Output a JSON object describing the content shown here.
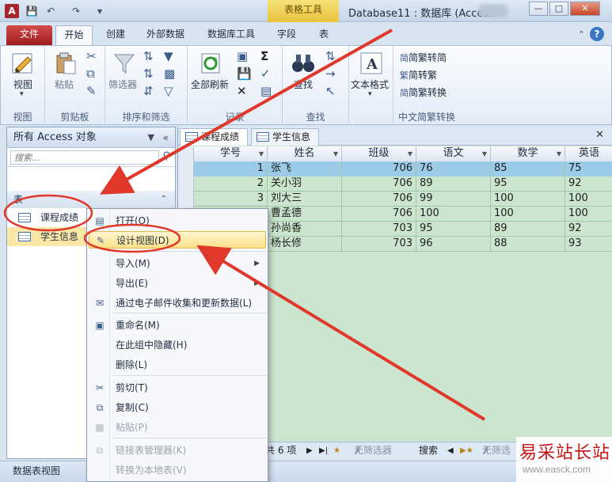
{
  "titlebar": {
    "app_icon": "A",
    "context_tab": "表格工具",
    "window_title": "Database11 : 数据库 (Access"
  },
  "ribbon_tabs": [
    "文件",
    "开始",
    "创建",
    "外部数据",
    "数据库工具",
    "字段",
    "表"
  ],
  "ribbon": {
    "view": "视图",
    "paste": "粘贴",
    "filter": "筛选器",
    "refresh_all": "全部刷新",
    "find": "查找",
    "text_format": "文本格式",
    "to_traditional": "简繁转简",
    "simp_to_trad": "简转繁",
    "simp_trad_convert": "简繁转换",
    "groups": {
      "view": "视图",
      "clipboard": "剪贴板",
      "sort_filter": "排序和筛选",
      "records": "记录",
      "find": "查找",
      "chinese_conv": "中文简繁转换"
    }
  },
  "nav": {
    "header": "所有 Access 对象",
    "search_placeholder": "搜索...",
    "group": "表",
    "items": [
      "课程成绩",
      "学生信息"
    ]
  },
  "doc_tabs": [
    "课程成绩",
    "学生信息"
  ],
  "grid": {
    "columns": [
      "学号",
      "姓名",
      "班级",
      "语文",
      "数学",
      "英语"
    ],
    "rows": [
      [
        "1",
        "张飞",
        "706",
        "76",
        "85",
        "75"
      ],
      [
        "2",
        "关小羽",
        "706",
        "89",
        "95",
        "92"
      ],
      [
        "3",
        "刘大三",
        "706",
        "99",
        "100",
        "100"
      ],
      [
        "",
        "曹孟德",
        "706",
        "100",
        "100",
        "100"
      ],
      [
        "",
        "孙尚香",
        "703",
        "95",
        "89",
        "92"
      ],
      [
        "",
        "杨长修",
        "703",
        "96",
        "88",
        "93"
      ]
    ]
  },
  "recnav": {
    "count": "共 6 项",
    "no_filter": "无筛选器",
    "search": "搜索",
    "no_filter2": "无筛选"
  },
  "status": "数据表视图",
  "context_menu": [
    {
      "label": "打开(O)",
      "icon": "open-icon",
      "disabled": false
    },
    {
      "label": "设计视图(D)",
      "icon": "design-view-icon",
      "disabled": false,
      "highlighted": true
    },
    {
      "label": "导入(M)",
      "icon": "",
      "disabled": false,
      "submenu": true
    },
    {
      "label": "导出(E)",
      "icon": "",
      "disabled": false,
      "submenu": true
    },
    {
      "label": "通过电子邮件收集和更新数据(L)",
      "icon": "email-icon",
      "disabled": false
    },
    {
      "label": "重命名(M)",
      "icon": "rename-icon",
      "disabled": false
    },
    {
      "label": "在此组中隐藏(H)",
      "icon": "",
      "disabled": false
    },
    {
      "label": "删除(L)",
      "icon": "",
      "disabled": false
    },
    {
      "label": "剪切(T)",
      "icon": "cut-icon",
      "disabled": false
    },
    {
      "label": "复制(C)",
      "icon": "copy-icon",
      "disabled": false
    },
    {
      "label": "粘贴(P)",
      "icon": "paste-icon",
      "disabled": true
    },
    {
      "label": "链接表管理器(K)",
      "icon": "link-manager-icon",
      "disabled": true
    },
    {
      "label": "转换为本地表(V)",
      "icon": "",
      "disabled": true
    }
  ],
  "watermark": {
    "title": "易采站长站",
    "url": "www.easck.com"
  },
  "colors": {
    "annotation": "#e0392b",
    "grid_bg": "#cbe5cf",
    "selected_row": "#9ccbe8",
    "file_tab": "#c0282d"
  }
}
